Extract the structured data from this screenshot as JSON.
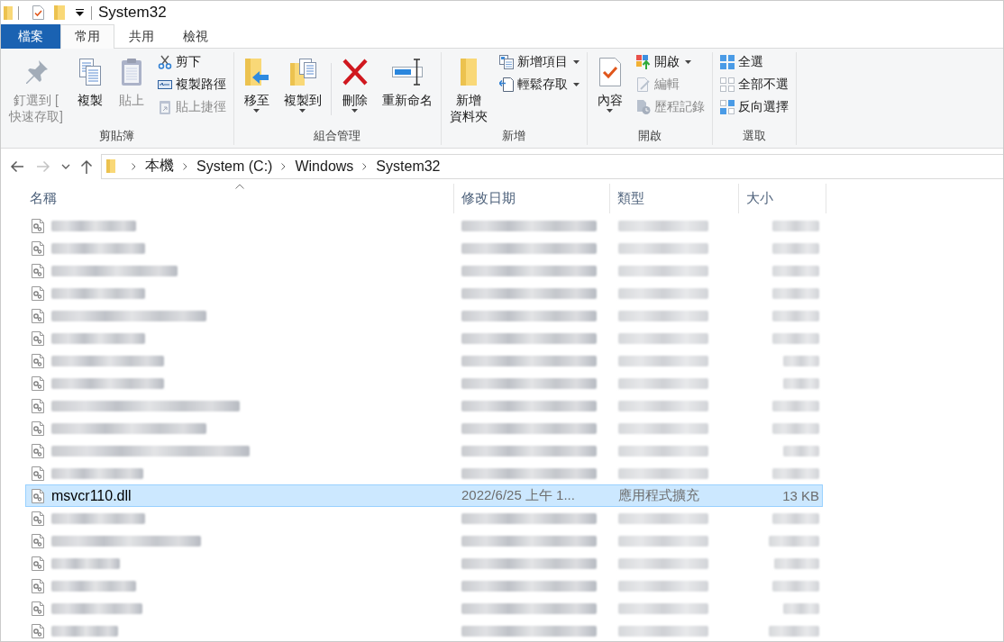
{
  "window": {
    "title": "System32"
  },
  "ribbon": {
    "tabs": [
      {
        "label": "檔案",
        "kind": "file",
        "selected": false
      },
      {
        "label": "常用",
        "kind": "tab",
        "selected": true
      },
      {
        "label": "共用",
        "kind": "tab",
        "selected": false
      },
      {
        "label": "檢視",
        "kind": "tab",
        "selected": false
      }
    ],
    "groups": [
      {
        "label": "剪貼簿",
        "items": [
          {
            "kind": "large",
            "label": "釘選到 [\n快速存取]",
            "disabled": true,
            "dropdown": false
          },
          {
            "kind": "large",
            "label": "複製",
            "disabled": false,
            "dropdown": false
          },
          {
            "kind": "large",
            "label": "貼上",
            "disabled": true,
            "dropdown": false
          },
          {
            "kind": "stack",
            "items": [
              {
                "label": "剪下",
                "disabled": false,
                "dropdown": false
              },
              {
                "label": "複製路徑",
                "disabled": false,
                "dropdown": false
              },
              {
                "label": "貼上捷徑",
                "disabled": true,
                "dropdown": false
              }
            ]
          }
        ]
      },
      {
        "label": "組合管理",
        "items": [
          {
            "kind": "large",
            "label": "移至",
            "disabled": false,
            "dropdown": true
          },
          {
            "kind": "large",
            "label": "複製到",
            "disabled": false,
            "dropdown": true
          },
          {
            "kind": "separator"
          },
          {
            "kind": "large",
            "label": "刪除",
            "disabled": false,
            "dropdown": true
          },
          {
            "kind": "large",
            "label": "重新命名",
            "disabled": false,
            "dropdown": false
          }
        ]
      },
      {
        "label": "新增",
        "items": [
          {
            "kind": "large",
            "label": "新增資料夾",
            "disabled": false,
            "dropdown": false
          },
          {
            "kind": "stack",
            "items": [
              {
                "label": "新增項目",
                "disabled": false,
                "dropdown": true
              },
              {
                "label": "輕鬆存取",
                "disabled": false,
                "dropdown": true
              }
            ]
          }
        ]
      },
      {
        "label": "開啟",
        "items": [
          {
            "kind": "large",
            "label": "內容",
            "disabled": false,
            "dropdown": true
          },
          {
            "kind": "stack",
            "items": [
              {
                "label": "開啟",
                "disabled": false,
                "dropdown": true
              },
              {
                "label": "編輯",
                "disabled": true,
                "dropdown": false
              },
              {
                "label": "歷程記錄",
                "disabled": true,
                "dropdown": false
              }
            ]
          }
        ]
      },
      {
        "label": "選取",
        "items": [
          {
            "kind": "stack",
            "items": [
              {
                "label": "全選",
                "disabled": false,
                "dropdown": false
              },
              {
                "label": "全部不選",
                "disabled": false,
                "dropdown": false
              },
              {
                "label": "反向選擇",
                "disabled": false,
                "dropdown": false
              }
            ]
          }
        ]
      }
    ]
  },
  "navigation": [
    {
      "kind": "back",
      "disabled": false
    },
    {
      "kind": "forward",
      "disabled": true
    },
    {
      "kind": "recent",
      "disabled": false
    },
    {
      "kind": "up",
      "disabled": false
    }
  ],
  "address_bar": {
    "path": [
      "本機",
      "System (C:)",
      "Windows",
      "System32"
    ]
  },
  "file_list": {
    "columns": [
      {
        "label": "名稱",
        "sorted": true
      },
      {
        "label": "修改日期",
        "sorted": false
      },
      {
        "label": "類型",
        "sorted": false
      },
      {
        "label": "大小",
        "sorted": false
      }
    ],
    "rows": [
      {
        "kind": "blurred",
        "selected": false
      },
      {
        "kind": "blurred",
        "selected": false
      },
      {
        "kind": "blurred",
        "selected": false
      },
      {
        "kind": "blurred",
        "selected": false
      },
      {
        "kind": "blurred",
        "selected": false
      },
      {
        "kind": "blurred",
        "selected": false
      },
      {
        "kind": "blurred",
        "selected": false
      },
      {
        "kind": "blurred",
        "selected": false
      },
      {
        "kind": "blurred",
        "selected": false
      },
      {
        "kind": "blurred",
        "selected": false
      },
      {
        "kind": "blurred",
        "selected": false
      },
      {
        "kind": "blurred",
        "selected": false
      },
      {
        "kind": "file",
        "selected": true,
        "name": "msvcr110.dll",
        "modified": "2022/6/25 上午 1...",
        "type": "應用程式擴充",
        "size": "13 KB"
      },
      {
        "kind": "blurred",
        "selected": false
      },
      {
        "kind": "blurred",
        "selected": false
      },
      {
        "kind": "blurred",
        "selected": false
      },
      {
        "kind": "blurred",
        "selected": false
      },
      {
        "kind": "blurred",
        "selected": false
      },
      {
        "kind": "blurred",
        "selected": false
      }
    ]
  }
}
